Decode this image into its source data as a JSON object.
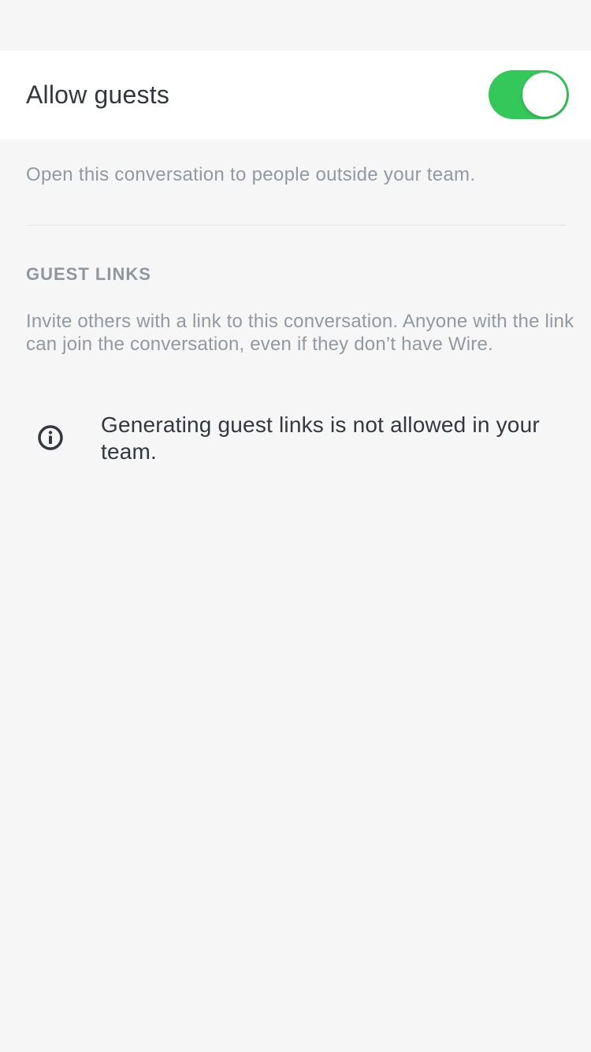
{
  "settings": {
    "allow_guests": {
      "label": "Allow guests",
      "enabled": true,
      "description": "Open this conversation to people outside your team."
    },
    "guest_links": {
      "section_title": "GUEST LINKS",
      "description": "Invite others with a link to this conversation. Anyone with the link can join the conversation, even if they don’t have Wire.",
      "notice_icon": "info-icon",
      "notice_text": "Generating guest links is not allowed in your team."
    }
  },
  "colors": {
    "toggle_on": "#34c759",
    "background": "#f6f6f6",
    "row_background": "#ffffff"
  }
}
